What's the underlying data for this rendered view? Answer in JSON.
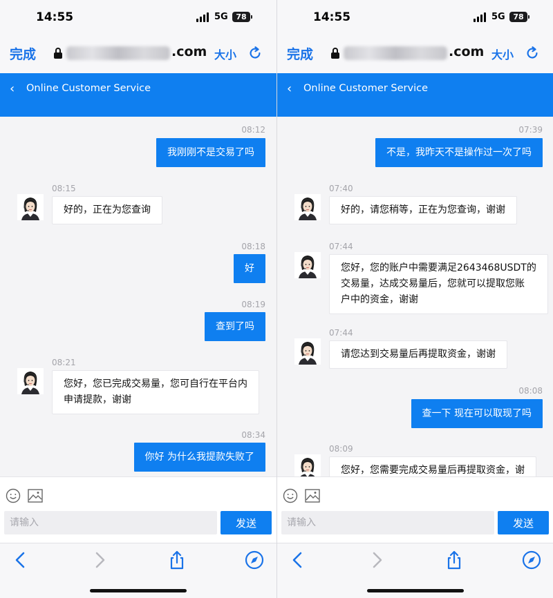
{
  "status": {
    "time": "14:55",
    "network": "5G",
    "battery": "78"
  },
  "browser": {
    "done_label": "完成",
    "url_suffix": ".com",
    "text_size_label": "大小"
  },
  "header": {
    "title": "Online Customer Service"
  },
  "composer": {
    "placeholder": "请输入",
    "send_label": "发送"
  },
  "colors": {
    "accent": "#0f7ff0",
    "chat_bg": "#f4f4f6",
    "incoming_bg": "#ffffff"
  },
  "icons": [
    "chevron-left-icon",
    "lock-icon",
    "reload-icon",
    "emoji-icon",
    "image-icon",
    "back-arrow-icon",
    "forward-arrow-icon",
    "share-icon",
    "compass-icon"
  ],
  "left_panel": {
    "messages": [
      {
        "dir": "out",
        "time": "08:12",
        "text": "我刚刚不是交易了吗"
      },
      {
        "dir": "in",
        "time": "08:15",
        "text": "好的，正在为您查询"
      },
      {
        "dir": "out",
        "time": "08:18",
        "text": "好"
      },
      {
        "dir": "out",
        "time": "08:19",
        "text": "查到了吗"
      },
      {
        "dir": "in",
        "time": "08:21",
        "text": "您好，您已完成交易量，您可自行在平台内\n申请提款，谢谢"
      },
      {
        "dir": "out",
        "time": "08:34",
        "text": "你好 为什么我提款失败了"
      }
    ]
  },
  "right_panel": {
    "messages": [
      {
        "dir": "out",
        "time": "07:39",
        "text": "不是，我昨天不是操作过一次了吗"
      },
      {
        "dir": "in",
        "time": "07:40",
        "text": "好的，请您稍等，正在为您查询，谢谢"
      },
      {
        "dir": "in",
        "time": "07:44",
        "text": "您好，您的账户中需要满足2643468USDT的\n交易量，达成交易量后，您就可以提取您账\n户中的资金，谢谢"
      },
      {
        "dir": "in",
        "time": "07:44",
        "text": "请您达到交易量后再提取资金，谢谢"
      },
      {
        "dir": "out",
        "time": "08:08",
        "text": "查一下 现在可以取现了吗"
      },
      {
        "dir": "in",
        "time": "08:09",
        "text": "您好，您需要完成交易量后再提取资金，谢"
      }
    ]
  }
}
